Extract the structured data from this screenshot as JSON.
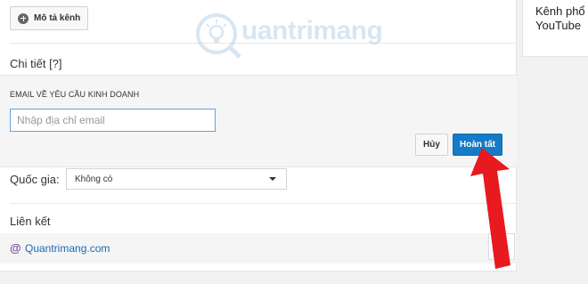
{
  "side_card": {
    "line1": "Kênh phổ",
    "line2": "YouTube"
  },
  "description_button": {
    "label": "Mô tả kênh",
    "icon": "plus-circle-icon"
  },
  "details": {
    "heading": "Chi tiết [?]"
  },
  "business_email": {
    "heading": "EMAIL VỀ YÊU CẦU KINH DOANH",
    "placeholder": "Nhập địa chỉ email",
    "value": "",
    "cancel_label": "Hủy",
    "done_label": "Hoàn tất"
  },
  "country": {
    "label": "Quốc gia:",
    "selected": "Không có"
  },
  "links": {
    "heading": "Liên kết",
    "site_label": "Quantrimang.com",
    "icon": "at-icon"
  },
  "watermark": {
    "text": "uantrimang"
  },
  "colors": {
    "accent": "#167ac6",
    "arrow": "#e8191f",
    "link": "#1a6bb5"
  }
}
